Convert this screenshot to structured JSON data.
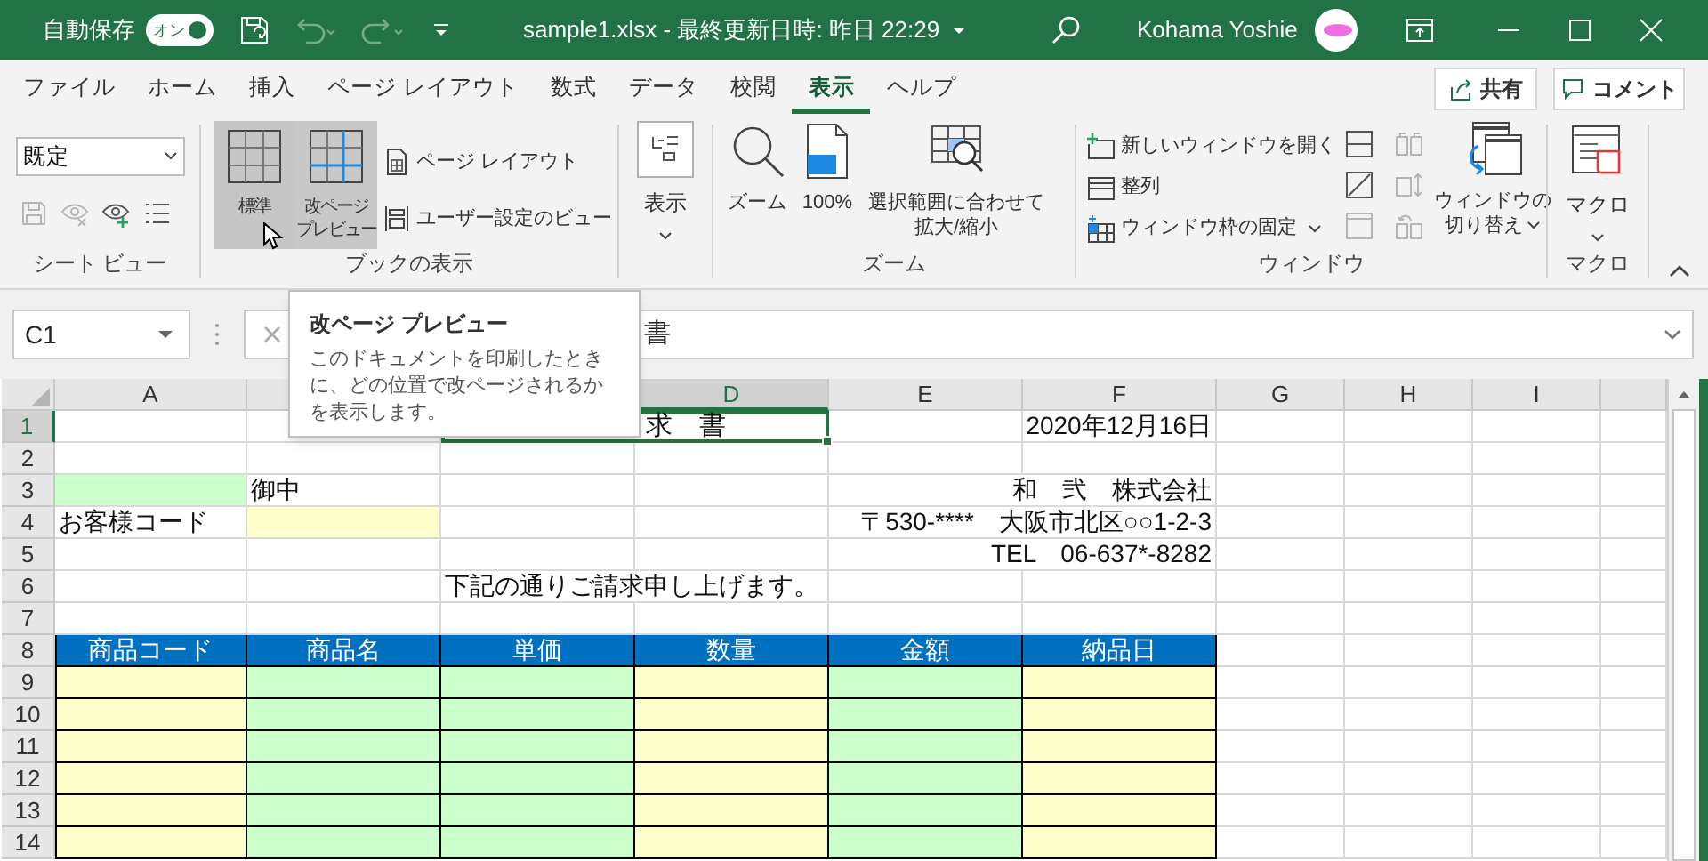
{
  "title_bar": {
    "autosave_label": "自動保存",
    "autosave_toggle": {
      "label": "オン",
      "on": true
    },
    "undo": {
      "disabled": true
    },
    "redo": {
      "disabled": true
    },
    "title": "sample1.xlsx - 最終更新日時: 昨日 22:29",
    "user": "Kohama Yoshie"
  },
  "ribbon_tabs": [
    {
      "label": "ファイル",
      "selected": false
    },
    {
      "label": "ホーム",
      "selected": false
    },
    {
      "label": "挿入",
      "selected": false
    },
    {
      "label": "ページ レイアウト",
      "selected": false
    },
    {
      "label": "数式",
      "selected": false
    },
    {
      "label": "データ",
      "selected": false
    },
    {
      "label": "校閲",
      "selected": false
    },
    {
      "label": "表示",
      "selected": true
    },
    {
      "label": "ヘルプ",
      "selected": false
    }
  ],
  "share_button": "共有",
  "comment_button": "コメント",
  "sheet_view": {
    "dropdown": "既定",
    "icons": [
      {
        "kind": "save",
        "disabled": true
      },
      {
        "kind": "exit",
        "disabled": true
      },
      {
        "kind": "new",
        "disabled": false
      },
      {
        "kind": "options",
        "disabled": false
      }
    ],
    "label": "シート ビュー"
  },
  "workbook_views": {
    "large_buttons": [
      {
        "label": [
          "標準"
        ],
        "selected": true,
        "hovered": false
      },
      {
        "label": [
          "改ページ",
          "プレビュー"
        ],
        "selected": false,
        "hovered": true
      }
    ],
    "small_buttons": [
      "ページ レイアウト",
      "ユーザー設定のビュー"
    ],
    "label": "ブックの表示"
  },
  "show": {
    "label": "表示"
  },
  "zoom": {
    "buttons": [
      [
        "ズーム"
      ],
      [
        "100%"
      ],
      [
        "選択範囲に合わせて",
        "拡大/縮小"
      ]
    ],
    "label": "ズーム"
  },
  "window": {
    "buttons": [
      {
        "label": "新しいウィンドウを開く",
        "dropdown": false
      },
      {
        "label": "整列",
        "dropdown": false
      },
      {
        "label": "ウィンドウ枠の固定",
        "dropdown": true
      }
    ],
    "view_icons": [
      {
        "kind": "split",
        "disabled": false
      },
      {
        "kind": "hide",
        "disabled": false
      },
      {
        "kind": "unhide",
        "disabled": true
      }
    ],
    "compare_icons": [
      {
        "kind": "side_by_side",
        "disabled": true
      },
      {
        "kind": "sync_scroll",
        "disabled": true
      },
      {
        "kind": "reset_position",
        "disabled": true
      }
    ],
    "switch_button": {
      "label": [
        "ウィンドウの",
        "切り替え"
      ],
      "dropdown": true
    },
    "label": "ウィンドウ"
  },
  "macro": {
    "button": "マクロ",
    "label": "マクロ"
  },
  "formula_bar": {
    "name_box": "C1",
    "formula": "書"
  },
  "tooltip": {
    "title": "改ページ プレビュー",
    "body": "このドキュメントを印刷したときに、どの位置で改ページされるかを表示します。"
  },
  "column_headers": [
    {
      "label": "A",
      "selected": false
    },
    {
      "label": "D",
      "selected": true
    },
    {
      "label": "E",
      "selected": false
    },
    {
      "label": "F",
      "selected": false
    },
    {
      "label": "G",
      "selected": false
    },
    {
      "label": "H",
      "selected": false
    },
    {
      "label": "I",
      "selected": false
    }
  ],
  "rows": [
    {
      "number": "1",
      "selected": true,
      "cells": [
        {
          "kind": "empty"
        },
        {
          "kind": "empty"
        },
        {
          "kind": "title",
          "text": "求　書",
          "selected": true
        },
        {
          "kind": "empty"
        },
        {
          "kind": "right",
          "text": "2020年12月16日"
        }
      ]
    },
    {
      "number": "2",
      "selected": false,
      "cells": [
        {
          "kind": "empty"
        },
        {
          "kind": "empty"
        },
        {
          "kind": "empty"
        },
        {
          "kind": "empty"
        },
        {
          "kind": "empty"
        },
        {
          "kind": "empty"
        }
      ]
    },
    {
      "number": "3",
      "selected": false,
      "cells": [
        {
          "kind": "input",
          "color": "#ccffcc"
        },
        {
          "kind": "text",
          "text": "御中"
        },
        {
          "kind": "empty"
        },
        {
          "kind": "empty"
        },
        {
          "kind": "empty"
        },
        {
          "kind": "right",
          "text": "和　弐　株式会社"
        }
      ]
    },
    {
      "number": "4",
      "selected": false,
      "cells": [
        {
          "kind": "text",
          "text": "お客様コード"
        },
        {
          "kind": "input",
          "color": "#ffffcc"
        },
        {
          "kind": "empty"
        },
        {
          "kind": "empty"
        },
        {
          "kind": "empty"
        },
        {
          "kind": "right",
          "text": "〒530-****　大阪市北区○○1-2-3"
        }
      ]
    },
    {
      "number": "5",
      "selected": false,
      "cells": [
        {
          "kind": "empty"
        },
        {
          "kind": "empty"
        },
        {
          "kind": "empty"
        },
        {
          "kind": "empty"
        },
        {
          "kind": "empty"
        },
        {
          "kind": "right",
          "text": "TEL　06-637*-8282"
        }
      ]
    },
    {
      "number": "6",
      "selected": false,
      "cells": [
        {
          "kind": "empty"
        },
        {
          "kind": "empty"
        },
        {
          "kind": "text",
          "text": "下記の通りご請求申し上げます。"
        },
        {
          "kind": "empty"
        },
        {
          "kind": "empty"
        },
        {
          "kind": "empty"
        }
      ]
    },
    {
      "number": "7",
      "selected": false,
      "cells": [
        {
          "kind": "empty"
        },
        {
          "kind": "empty"
        },
        {
          "kind": "empty"
        },
        {
          "kind": "empty"
        },
        {
          "kind": "empty"
        },
        {
          "kind": "empty"
        }
      ]
    },
    {
      "number": "8",
      "selected": false,
      "cells": [
        {
          "kind": "heading",
          "text": "商品コード"
        },
        {
          "kind": "heading",
          "text": "商品名"
        },
        {
          "kind": "heading",
          "text": "単価"
        },
        {
          "kind": "heading",
          "text": "数量"
        },
        {
          "kind": "heading",
          "text": "金額"
        },
        {
          "kind": "heading",
          "text": "納品日"
        }
      ]
    },
    {
      "number": "9",
      "selected": false,
      "cells": [
        {
          "kind": "entry",
          "color": "#ffffcc"
        },
        {
          "kind": "entry",
          "color": "#ccffcc"
        },
        {
          "kind": "entry",
          "color": "#ccffcc"
        },
        {
          "kind": "entry",
          "color": "#ffffcc"
        },
        {
          "kind": "entry",
          "color": "#ccffcc"
        },
        {
          "kind": "entry",
          "color": "#ffffcc"
        }
      ]
    },
    {
      "number": "10",
      "selected": false,
      "cells": [
        {
          "kind": "entry",
          "color": "#ffffcc"
        },
        {
          "kind": "entry",
          "color": "#ccffcc"
        },
        {
          "kind": "entry",
          "color": "#ccffcc"
        },
        {
          "kind": "entry",
          "color": "#ffffcc"
        },
        {
          "kind": "entry",
          "color": "#ccffcc"
        },
        {
          "kind": "entry",
          "color": "#ffffcc"
        }
      ]
    },
    {
      "number": "11",
      "selected": false,
      "cells": [
        {
          "kind": "entry",
          "color": "#ffffcc"
        },
        {
          "kind": "entry",
          "color": "#ccffcc"
        },
        {
          "kind": "entry",
          "color": "#ccffcc"
        },
        {
          "kind": "entry",
          "color": "#ffffcc"
        },
        {
          "kind": "entry",
          "color": "#ccffcc"
        },
        {
          "kind": "entry",
          "color": "#ffffcc"
        }
      ]
    },
    {
      "number": "12",
      "selected": false,
      "cells": [
        {
          "kind": "entry",
          "color": "#ffffcc"
        },
        {
          "kind": "entry",
          "color": "#ccffcc"
        },
        {
          "kind": "entry",
          "color": "#ccffcc"
        },
        {
          "kind": "entry",
          "color": "#ffffcc"
        },
        {
          "kind": "entry",
          "color": "#ccffcc"
        },
        {
          "kind": "entry",
          "color": "#ffffcc"
        }
      ]
    },
    {
      "number": "13",
      "selected": false,
      "cells": [
        {
          "kind": "entry",
          "color": "#ffffcc"
        },
        {
          "kind": "entry",
          "color": "#ccffcc"
        },
        {
          "kind": "entry",
          "color": "#ccffcc"
        },
        {
          "kind": "entry",
          "color": "#ffffcc"
        },
        {
          "kind": "entry",
          "color": "#ccffcc"
        },
        {
          "kind": "entry",
          "color": "#ffffcc"
        }
      ]
    },
    {
      "number": "14",
      "selected": false,
      "cells": [
        {
          "kind": "entry",
          "color": "#ffffcc"
        },
        {
          "kind": "entry",
          "color": "#ccffcc"
        },
        {
          "kind": "entry",
          "color": "#ccffcc"
        },
        {
          "kind": "entry",
          "color": "#ffffcc"
        },
        {
          "kind": "entry",
          "color": "#ccffcc"
        },
        {
          "kind": "entry",
          "color": "#ffffcc"
        }
      ]
    }
  ]
}
